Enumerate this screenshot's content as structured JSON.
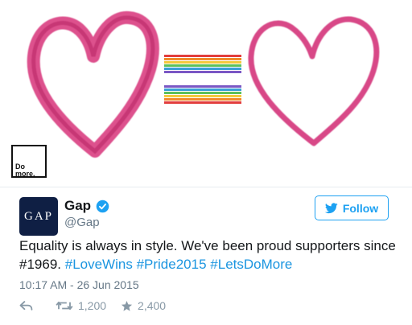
{
  "hero": {
    "badge_line1": "Do",
    "badge_line2": "more."
  },
  "profile": {
    "avatar_text": "GAP",
    "name": "Gap",
    "handle": "@Gap",
    "verified": true
  },
  "follow": {
    "label": "Follow"
  },
  "tweet": {
    "text": "Equality is always in style. We've been proud supporters since #1969. ",
    "hashtags": [
      "#LoveWins",
      "#Pride2015",
      "#LetsDoMore"
    ],
    "timestamp": "10:17 AM - 26 Jun 2015"
  },
  "stats": {
    "retweets": "1,200",
    "likes": "2,400"
  },
  "colors": {
    "link": "#1b95e0",
    "follow_blue": "#1da1f2",
    "heart": "#d4337a",
    "avatar_bg": "#0f1f44"
  },
  "icons": [
    "bird-icon",
    "verified-badge-icon",
    "reply-icon",
    "retweet-icon",
    "star-icon"
  ]
}
